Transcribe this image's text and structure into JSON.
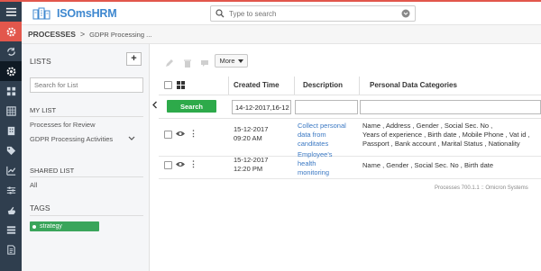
{
  "app": {
    "logo_text": "ISOmsHRM"
  },
  "header": {
    "search_placeholder": "Type to search"
  },
  "breadcrumb": {
    "section": "PROCESSES",
    "separator": ">",
    "page": "GDPR Processing ..."
  },
  "left_panel": {
    "title": "LISTS",
    "add_label": "+",
    "search_placeholder": "Search for List",
    "my_list_title": "MY LIST",
    "my_list_items": [
      "Processes for Review",
      "GDPR Processing Activities"
    ],
    "shared_list_title": "SHARED LIST",
    "shared_items": [
      "All"
    ],
    "tags_title": "TAGS",
    "tags": [
      "strategy"
    ]
  },
  "toolbar": {
    "more_label": "More"
  },
  "table": {
    "columns": [
      "Created Time",
      "Description",
      "Personal Data Categories"
    ],
    "search_label": "Search",
    "created_filter_value": "14-12-2017,16-12",
    "rows": [
      {
        "created_date": "15-12-2017",
        "created_time": "09:20 AM",
        "description_lines": [
          "Collect personal",
          "data from",
          "canditates"
        ],
        "categories_lines": [
          "Name , Address , Gender , Social Sec. No ,",
          "Years of experience , Birth date , Mobile Phone , Vat id ,",
          "Passport , Bank account , Marital Status , Nationality"
        ]
      },
      {
        "created_date": "15-12-2017",
        "created_time": "12:20 PM",
        "description_lines": [
          "Employee's",
          "health",
          "monitoring"
        ],
        "categories_lines": [
          "Name , Gender , Social Sec. No , Birth date"
        ]
      }
    ]
  },
  "footer": {
    "text": "Processes 700.1.1 :: Omicron Systems"
  },
  "colors": {
    "accent": "#e2574c",
    "rail": "#2f3e4e",
    "search_button": "#2daa4a",
    "link": "#3a78c3",
    "tag": "#3aa55b"
  }
}
